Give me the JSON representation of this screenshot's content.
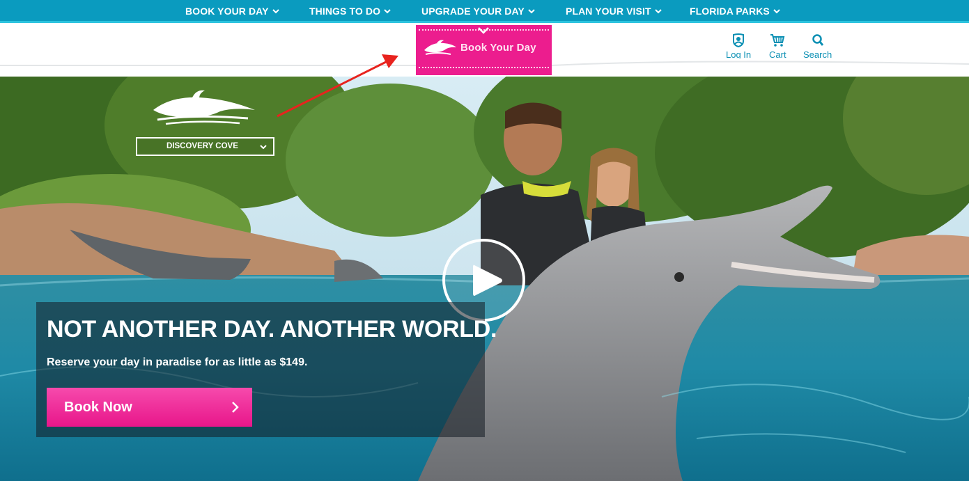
{
  "topnav": {
    "items": [
      {
        "label": "BOOK YOUR DAY"
      },
      {
        "label": "THINGS TO DO"
      },
      {
        "label": "UPGRADE YOUR DAY"
      },
      {
        "label": "PLAN YOUR VISIT"
      },
      {
        "label": "FLORIDA PARKS"
      }
    ],
    "colors": {
      "bar": "#0a9bbf",
      "accent_line": "#2cc3de",
      "text": "#ffffff"
    }
  },
  "ribbon": {
    "label": "Book Your Day",
    "color": "#ec1d8e",
    "icon": "dolphin-logo-icon"
  },
  "header_tools": [
    {
      "label": "Log In",
      "icon": "user-icon"
    },
    {
      "label": "Cart",
      "icon": "cart-icon"
    },
    {
      "label": "Search",
      "icon": "search-icon"
    }
  ],
  "park_selector": {
    "selected": "DISCOVERY COVE",
    "icon": "chevron-down-icon"
  },
  "hero": {
    "headline": "NOT ANOTHER DAY. ANOTHER WORLD.",
    "subtext": "Reserve your day in paradise for as little as $149.",
    "cta_label": "Book Now",
    "cta_color": "#ec1d8e",
    "video_icon": "play-icon"
  },
  "annotation": {
    "color": "#e8231e",
    "icon": "red-arrow"
  }
}
